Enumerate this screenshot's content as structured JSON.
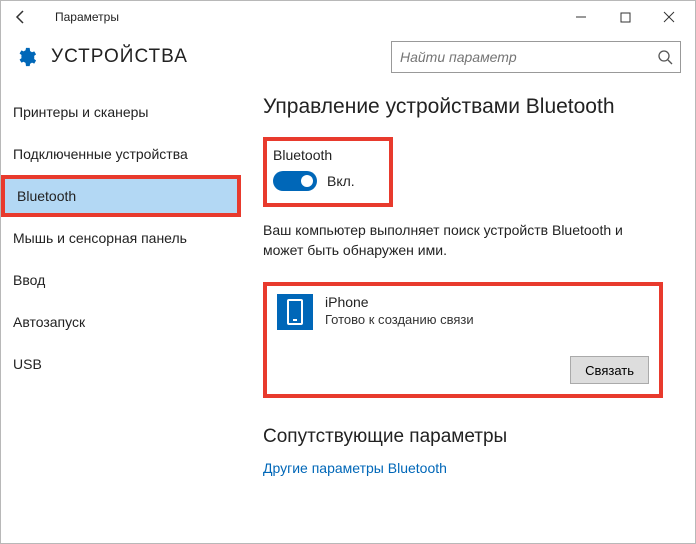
{
  "window": {
    "title": "Параметры"
  },
  "header": {
    "section": "УСТРОЙСТВА",
    "search_placeholder": "Найти параметр"
  },
  "sidebar": {
    "items": [
      {
        "label": "Принтеры и сканеры"
      },
      {
        "label": "Подключенные устройства"
      },
      {
        "label": "Bluetooth"
      },
      {
        "label": "Мышь и сенсорная панель"
      },
      {
        "label": "Ввод"
      },
      {
        "label": "Автозапуск"
      },
      {
        "label": "USB"
      }
    ],
    "selected_index": 2
  },
  "main": {
    "heading": "Управление устройствами Bluetooth",
    "bluetooth_label": "Bluetooth",
    "toggle_state": "Вкл.",
    "info_text": "Ваш компьютер выполняет поиск устройств Bluetooth и может быть обнаружен ими.",
    "device": {
      "name": "iPhone",
      "status": "Готово к созданию связи",
      "pair_label": "Связать"
    },
    "related_heading": "Сопутствующие параметры",
    "related_link": "Другие параметры Bluetooth"
  }
}
